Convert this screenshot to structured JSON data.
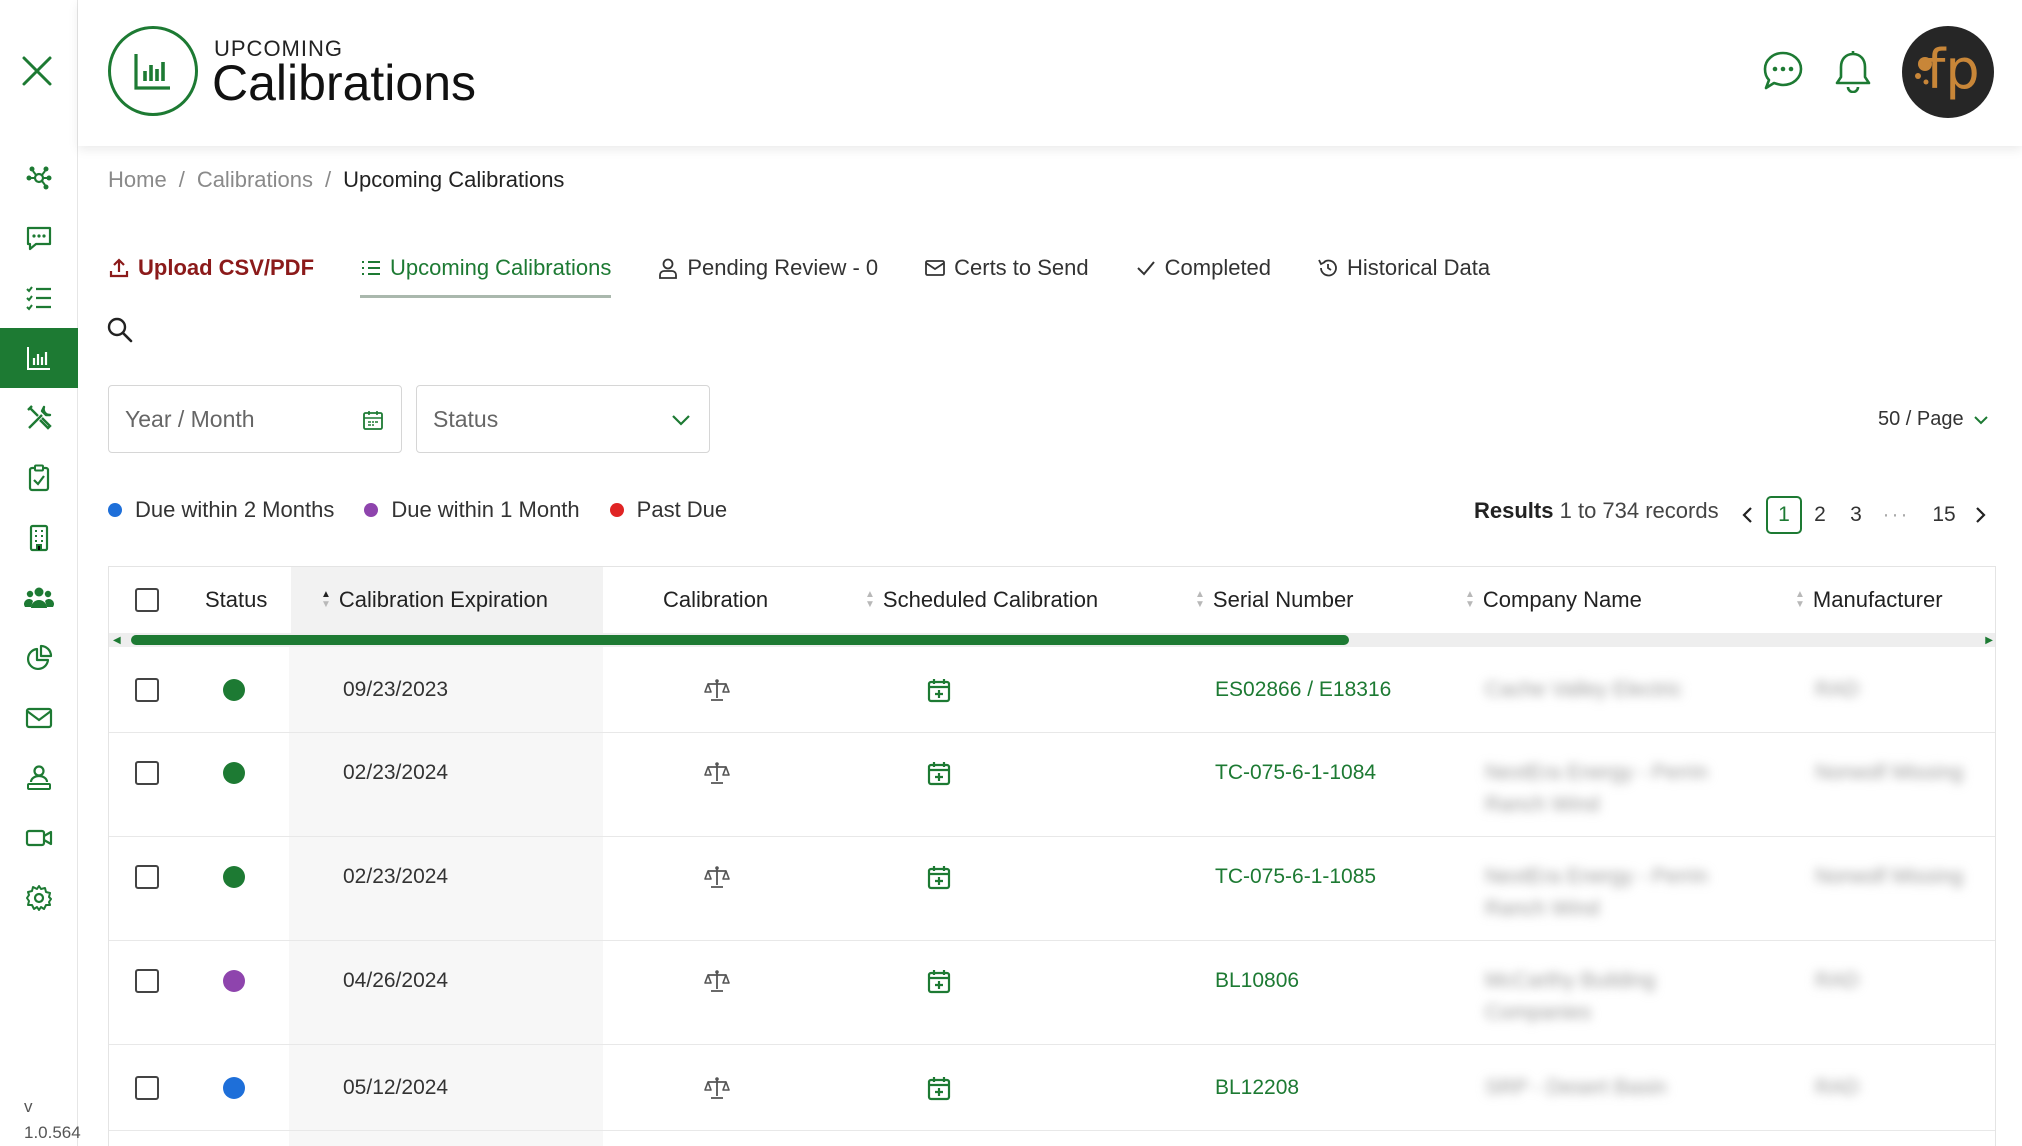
{
  "header": {
    "title_small": "UPCOMING",
    "title_big": "Calibrations",
    "avatar_initials": "fp"
  },
  "sidebar": {
    "version_label": "v",
    "version_number": "1.0.564",
    "items": [
      {
        "icon": "network-icon",
        "active": false
      },
      {
        "icon": "chat-icon",
        "active": false
      },
      {
        "icon": "checklist-icon",
        "active": false
      },
      {
        "icon": "bar-chart-icon",
        "active": true
      },
      {
        "icon": "tools-icon",
        "active": false
      },
      {
        "icon": "clipboard-check-icon",
        "active": false
      },
      {
        "icon": "building-icon",
        "active": false
      },
      {
        "icon": "users-icon",
        "active": false
      },
      {
        "icon": "pie-chart-icon",
        "active": false
      },
      {
        "icon": "mail-icon",
        "active": false
      },
      {
        "icon": "user-group-icon",
        "active": false
      },
      {
        "icon": "video-icon",
        "active": false
      },
      {
        "icon": "settings-icon",
        "active": false
      }
    ]
  },
  "breadcrumb": {
    "home": "Home",
    "sep": "/",
    "calibrations": "Calibrations",
    "current": "Upcoming Calibrations"
  },
  "tabs": {
    "upload": "Upload CSV/PDF",
    "upcoming": "Upcoming Calibrations",
    "pending": "Pending Review - 0",
    "certs": "Certs to Send",
    "completed": "Completed",
    "historical": "Historical Data"
  },
  "filters": {
    "year_month_placeholder": "Year / Month",
    "status_placeholder": "Status",
    "per_page": "50 / Page"
  },
  "legend": {
    "two_months": "Due within 2 Months",
    "one_month": "Due within 1 Month",
    "past_due": "Past Due"
  },
  "colors": {
    "brand_green": "#1d7a33",
    "blue": "#1e6fd9",
    "purple": "#8e44ad",
    "red": "#e02424"
  },
  "results": {
    "label": "Results",
    "text": "1 to 734 records"
  },
  "pagination": {
    "pages": [
      "1",
      "2",
      "3",
      "···",
      "15"
    ],
    "current": "1"
  },
  "table": {
    "columns": {
      "status": "Status",
      "expiration": "Calibration Expiration",
      "calibration": "Calibration",
      "scheduled": "Scheduled Calibration",
      "serial": "Serial Number",
      "company": "Company Name",
      "manufacturer": "Manufacturer"
    },
    "rows": [
      {
        "status": "green",
        "expiration": "09/23/2023",
        "serial": "ES02866 / E18316",
        "company": "Cache Valley Electric",
        "manufacturer": "RAD"
      },
      {
        "status": "green",
        "expiration": "02/23/2024",
        "serial": "TC-075-6-1-1084",
        "company": "NextEra Energy - Perrin Ranch Wind",
        "manufacturer": "Norwolf Missing"
      },
      {
        "status": "green",
        "expiration": "02/23/2024",
        "serial": "TC-075-6-1-1085",
        "company": "NextEra Energy - Perrin Ranch Wind",
        "manufacturer": "Norwolf Missing"
      },
      {
        "status": "purple",
        "expiration": "04/26/2024",
        "serial": "BL10806",
        "company": "McCarthy Building Companies",
        "manufacturer": "RAD"
      },
      {
        "status": "blue",
        "expiration": "05/12/2024",
        "serial": "BL12208",
        "company": "SRP - Desert Basin",
        "manufacturer": "RAD"
      }
    ]
  }
}
